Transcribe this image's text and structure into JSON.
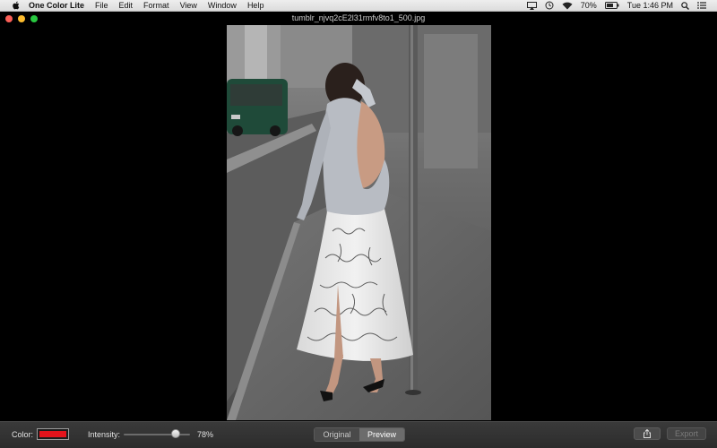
{
  "menubar": {
    "app_name": "One Color Lite",
    "menus": [
      "File",
      "Edit",
      "Format",
      "View",
      "Window",
      "Help"
    ],
    "battery": "70%",
    "clock": "Tue 1:46 PM"
  },
  "window": {
    "title": "tumblr_njvq2cE2l31rmfv8to1_500.jpg"
  },
  "toolbar": {
    "color_label": "Color:",
    "color_value": "#e5141c",
    "intensity_label": "Intensity:",
    "intensity_value": 0.78,
    "intensity_text": "78%",
    "view_modes": [
      "Original",
      "Preview"
    ],
    "selected_view": "Preview",
    "export_label": "Export"
  }
}
